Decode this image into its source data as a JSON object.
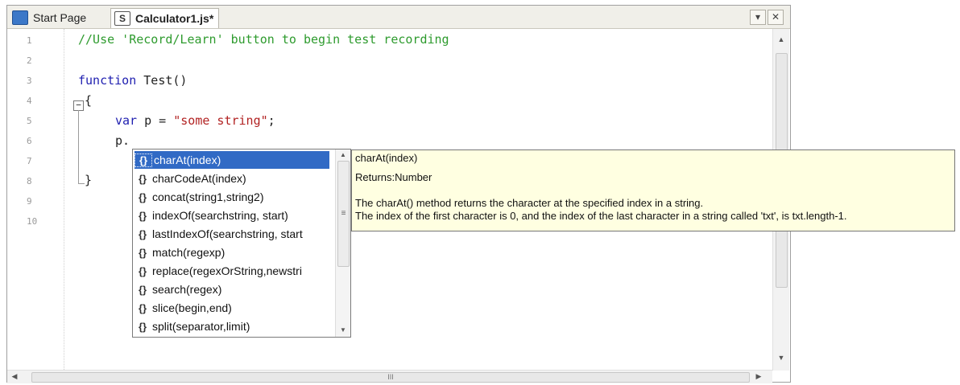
{
  "tabs": {
    "start": "Start Page",
    "active": "Calculator1.js*"
  },
  "window_buttons": {
    "dropdown": "▾",
    "close": "✕"
  },
  "gutter": {
    "line_numbers": [
      "1",
      "2",
      "3",
      "4",
      "5",
      "6",
      "7",
      "8",
      "9",
      "10"
    ]
  },
  "code": {
    "line1": "//Use 'Record/Learn' button to begin test recording",
    "line3_kw": "function",
    "line3_rest": " Test()",
    "line4": "{",
    "line5_kw": "var",
    "line5_mid": " p = ",
    "line5_str": "\"some string\"",
    "line5_end": ";",
    "line6": "p.",
    "line8": "}"
  },
  "completion": {
    "icon": "{}",
    "items": [
      "charAt(index)",
      "charCodeAt(index)",
      "concat(string1,string2)",
      "indexOf(searchstring, start)",
      "lastIndexOf(searchstring, start",
      "match(regexp)",
      "replace(regexOrString,newstri",
      "search(regex)",
      "slice(begin,end)",
      "split(separator,limit)"
    ],
    "selected_index": 0
  },
  "tooltip": {
    "signature": "charAt(index)",
    "returns": "Returns:Number",
    "desc1": "The charAt() method returns the character at the specified index in a string.",
    "desc2": "The index of the first character is 0, and the index of the last character in a string called 'txt', is txt.length-1."
  },
  "scroll": {
    "grip": "≡",
    "hgrip": "III"
  },
  "colors": {
    "comment": "#2e9b2e",
    "keyword": "#1f1fb0",
    "string": "#b22222",
    "selection": "#316ac5",
    "tooltip_bg": "#ffffe1"
  }
}
